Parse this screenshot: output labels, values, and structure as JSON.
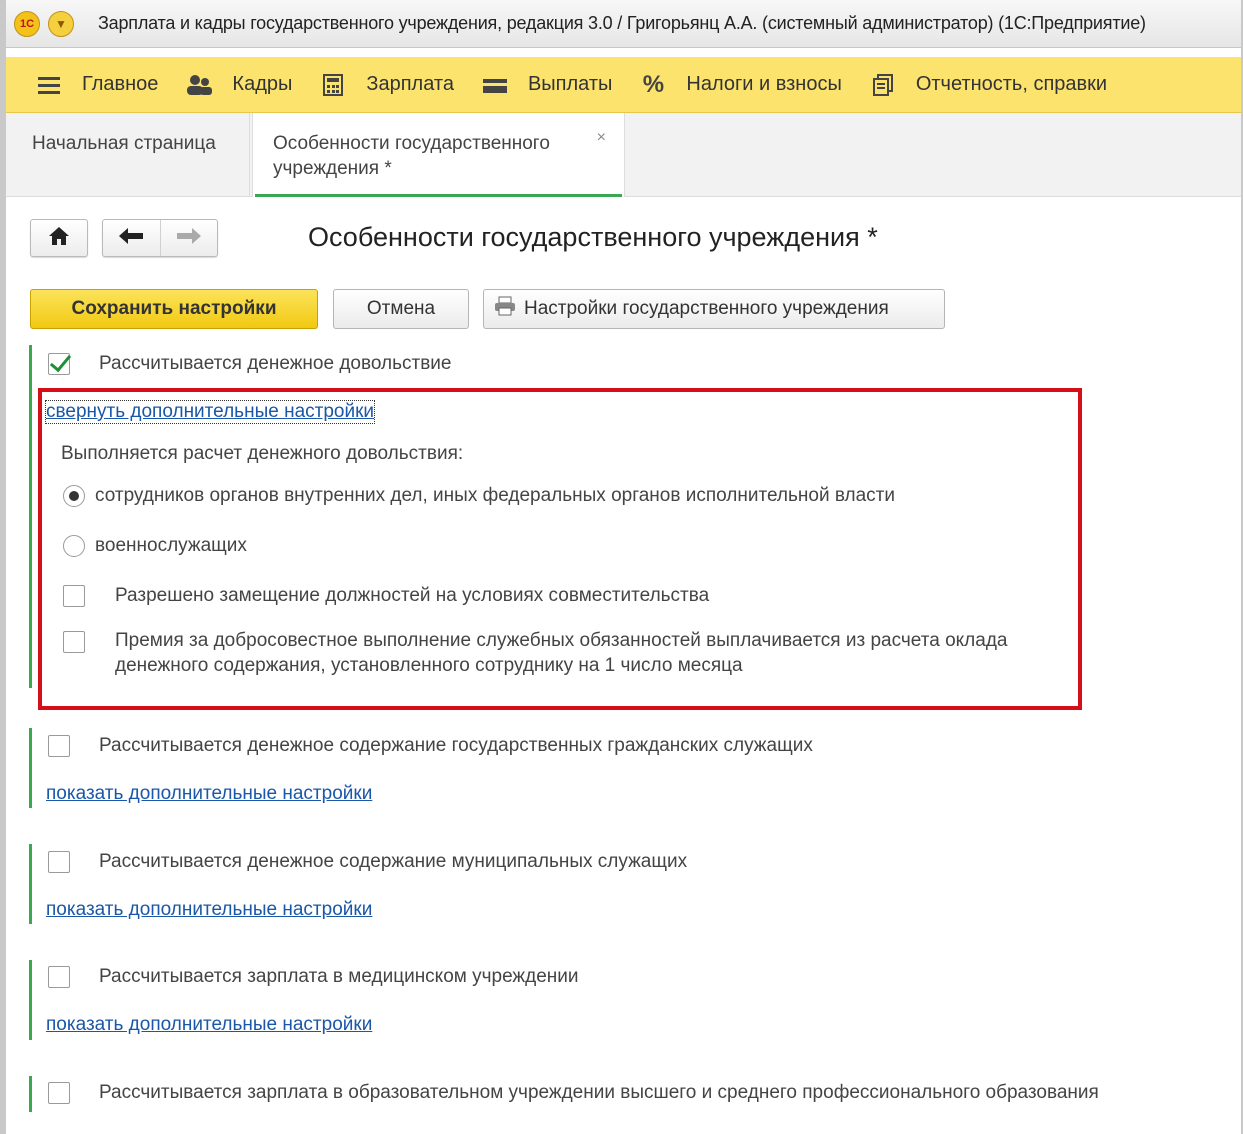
{
  "window": {
    "title": "Зарплата и кадры государственного учреждения, редакция 3.0 / Григорьянц А.А. (системный администратор)  (1С:Предприятие)",
    "logo_text": "1С"
  },
  "main_menu": [
    {
      "label": "Главное",
      "icon": "list-icon"
    },
    {
      "label": "Кадры",
      "icon": "people-icon"
    },
    {
      "label": "Зарплата",
      "icon": "calculator-icon"
    },
    {
      "label": "Выплаты",
      "icon": "wallet-icon"
    },
    {
      "label": "Налоги и взносы",
      "icon": "percent-icon"
    },
    {
      "label": "Отчетность, справки",
      "icon": "documents-icon"
    }
  ],
  "tabs": {
    "home": "Начальная страница",
    "active": "Особенности государственного учреждения *",
    "close": "×"
  },
  "form": {
    "title": "Особенности государственного учреждения *",
    "save_label": "Сохранить настройки",
    "cancel_label": "Отмена",
    "settings_label": "Настройки государственного учреждения"
  },
  "sections": {
    "s1": {
      "label": "Рассчитывается денежное довольствие",
      "checked": true,
      "link": "свернуть дополнительные настройки",
      "group_label": "Выполняется расчет денежного довольствия:",
      "radio1": "сотрудников органов внутренних дел, иных федеральных органов исполнительной власти",
      "radio2": "военнослужащих",
      "option1": "Разрешено замещение должностей на условиях совместительства",
      "option2_line1": "Премия за добросовестное выполнение служебных обязанностей выплачивается из расчета оклада",
      "option2_line2": "денежного содержания, установленного сотруднику на 1 число месяца"
    },
    "s2": {
      "label": "Рассчитывается денежное содержание государственных гражданских служащих",
      "link": "показать дополнительные настройки"
    },
    "s3": {
      "label": "Рассчитывается денежное содержание муниципальных служащих",
      "link": "показать дополнительные настройки"
    },
    "s4": {
      "label": "Рассчитывается зарплата в медицинском учреждении",
      "link": "показать дополнительные настройки"
    },
    "s5": {
      "label": "Рассчитывается зарплата в образовательном учреждении высшего и среднего профессионального образования"
    }
  },
  "colors": {
    "menu_bg": "#fbe36e",
    "accent_green": "#3aa850",
    "highlight_red": "#d40f1a",
    "link_blue": "#1a57a8"
  }
}
